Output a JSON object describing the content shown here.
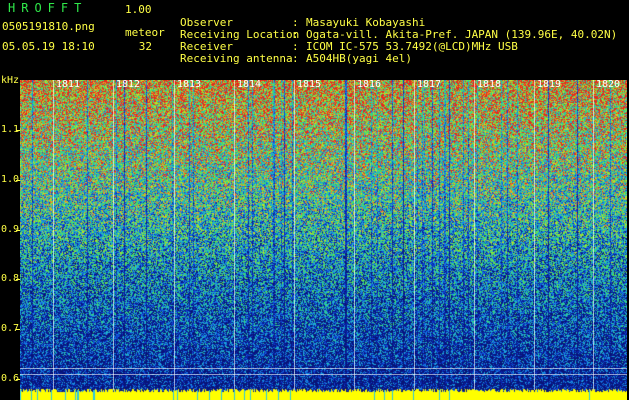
{
  "header": {
    "brand": "HROFFT",
    "version": "1.00",
    "filename": "0505191810.png",
    "meteor_label": "meteor",
    "meteor_count": "32",
    "datetime": "05.05.19 18:10"
  },
  "info": [
    {
      "key": "Observer",
      "value": "Masayuki Kobayashi"
    },
    {
      "key": "Receiving Location",
      "value": "Ogata-vill. Akita-Pref. JAPAN (139.96E, 40.02N)"
    },
    {
      "key": "Receiver",
      "value": "ICOM IC-575 53.7492(@LCD)MHz USB"
    },
    {
      "key": "Receiving antenna",
      "value": "A504HB(yagi 4el)"
    }
  ],
  "spectrogram": {
    "y_unit": "kHz",
    "y_ticks": [
      "1.1",
      "1.0",
      "0.9",
      "0.8",
      "0.7",
      "0.6"
    ],
    "x_ticks": [
      "1811",
      "1812",
      "1813",
      "1814",
      "1815",
      "1816",
      "1817",
      "1818",
      "1819",
      "1820"
    ],
    "colors": {
      "text_yellow": "#ffff46",
      "text_green": "#2fe84a",
      "background": "#000000",
      "noise_low": "#0a1fa8",
      "noise_high": "#2fe84a",
      "baseline": "#ffff00"
    }
  }
}
